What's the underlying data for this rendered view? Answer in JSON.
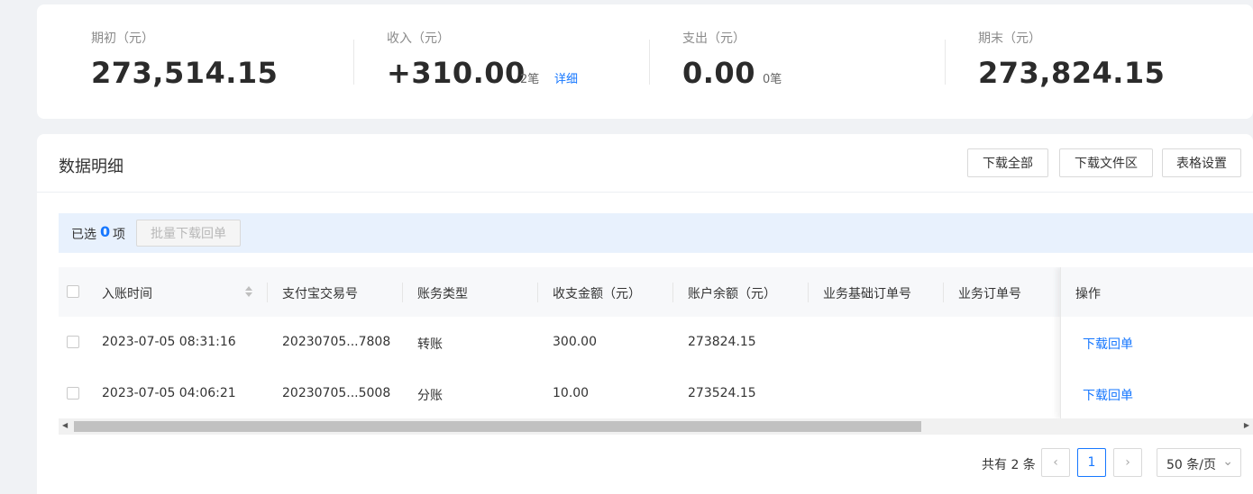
{
  "summary": {
    "opening": {
      "label": "期初（元）",
      "value": "273,514.15"
    },
    "income": {
      "label": "收入（元）",
      "value": "+310.00",
      "count": "2笔",
      "detail_link": "详细"
    },
    "expense": {
      "label": "支出（元）",
      "value": "0.00",
      "count": "0笔"
    },
    "closing": {
      "label": "期末（元）",
      "value": "273,824.15"
    }
  },
  "detail": {
    "title": "数据明细",
    "buttons": {
      "download_all": "下载全部",
      "download_files": "下载文件区",
      "table_settings": "表格设置"
    },
    "selection": {
      "prefix": "已选",
      "count": "0",
      "suffix": "项",
      "batch_button": "批量下载回单"
    }
  },
  "table": {
    "columns": [
      "入账时间",
      "支付宝交易号",
      "账务类型",
      "收支金额（元）",
      "账户余额（元）",
      "业务基础订单号",
      "业务订单号",
      "操作"
    ],
    "rows": [
      {
        "time": "2023-07-05 08:31:16",
        "trade_no": "20230705...7808",
        "type": "转账",
        "amount": "300.00",
        "balance": "273824.15",
        "base_order": "",
        "order": "",
        "action": "下载回单"
      },
      {
        "time": "2023-07-05 04:06:21",
        "trade_no": "20230705...5008",
        "type": "分账",
        "amount": "10.00",
        "balance": "273524.15",
        "base_order": "",
        "order": "",
        "action": "下载回单"
      }
    ]
  },
  "pagination": {
    "total": "共有 2 条",
    "current_page": "1",
    "page_size": "50 条/页"
  },
  "icons": {
    "prev": "chevron-left-icon",
    "next": "chevron-right-icon",
    "sort": "sort-icon",
    "dropdown": "chevron-down-icon"
  },
  "colors": {
    "accent": "#1677ff",
    "selection_bg": "#e8f1fd"
  }
}
